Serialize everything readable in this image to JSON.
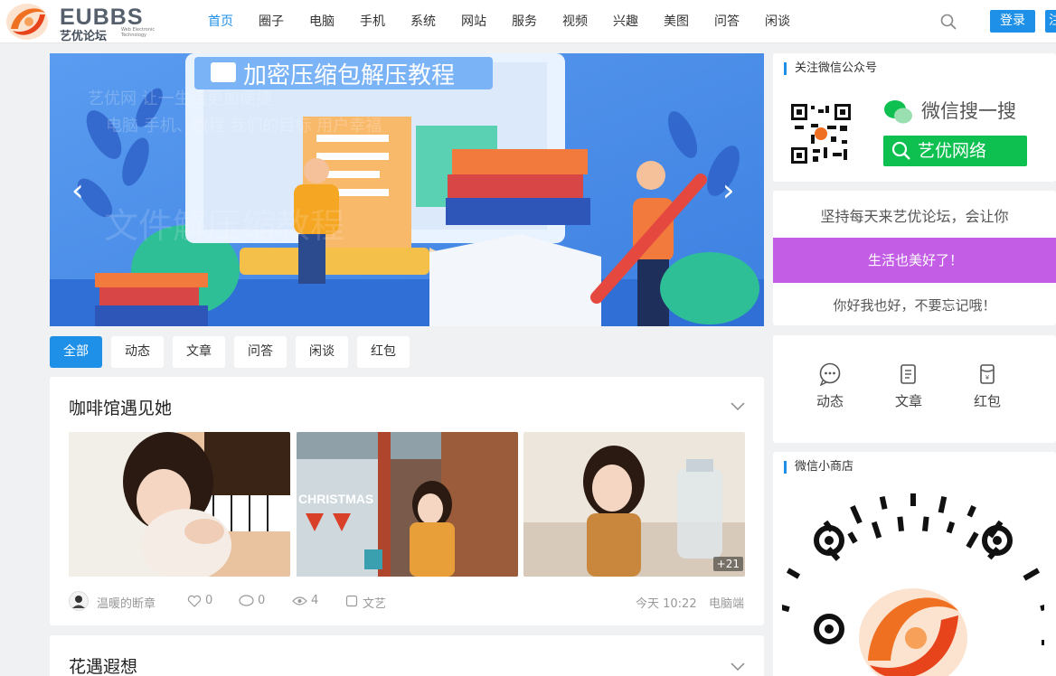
{
  "header": {
    "logo": {
      "name": "EUBBS",
      "cn": "艺优论坛",
      "en": "Web Electronic Technology"
    },
    "nav": [
      "首页",
      "圈子",
      "电脑",
      "手机",
      "系统",
      "网站",
      "服务",
      "视频",
      "兴趣",
      "美图",
      "问答",
      "闲谈"
    ],
    "active_nav": 0,
    "login_label": "登录",
    "register_label": "注"
  },
  "banner": {
    "title": "加密压缩包解压教程",
    "watermark_line1": "艺优网 让一生活更加便捷",
    "watermark_line2": "电脑 手机、教程 我们的目标 用户幸福",
    "watermark_big": "文件解压缩教程",
    "slide_count": 4,
    "active_slide": 2
  },
  "tabs": [
    "全部",
    "动态",
    "文章",
    "问答",
    "闲谈",
    "红包"
  ],
  "active_tab": 0,
  "post": {
    "title": "咖啡馆遇见她",
    "images_extra": "+21",
    "christmas_text": "CHRISTMAS",
    "author": "温暖的断章",
    "likes": "0",
    "comments": "0",
    "views": "4",
    "category": "文艺",
    "time": "今天 10:22",
    "source": "电脑端"
  },
  "post2": {
    "title": "花遇遐想"
  },
  "sidebar": {
    "wechat_title": "关注微信公众号",
    "wechat_search": "微信搜一搜",
    "wechat_account": "艺优网络",
    "motto_line1": "坚持每天来艺优论坛，会让你",
    "motto_highlight": "生活也美好了！",
    "motto_line2": "你好我也好，不要忘记哦！",
    "quick_links": [
      "动态",
      "文章",
      "红包"
    ],
    "shop_title": "微信小商店"
  },
  "colors": {
    "accent": "#1e90e8",
    "purple": "#c35de6",
    "wechat_green": "#0dc04f",
    "logo_orange": "#f07022"
  }
}
